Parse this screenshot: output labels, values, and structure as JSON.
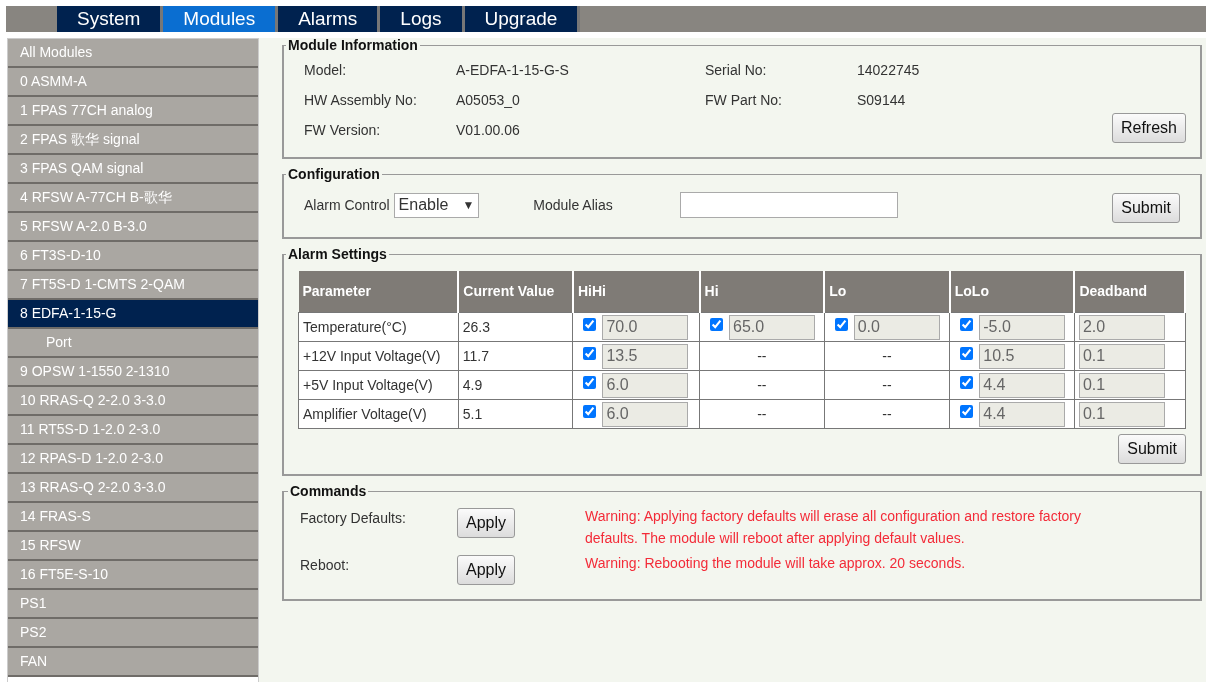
{
  "nav_tabs": [
    {
      "label": "System",
      "selected": false
    },
    {
      "label": "Modules",
      "selected": true
    },
    {
      "label": "Alarms",
      "selected": false
    },
    {
      "label": "Logs",
      "selected": false
    },
    {
      "label": "Upgrade",
      "selected": false
    }
  ],
  "sidebar": {
    "items": [
      {
        "label": "All Modules",
        "selected": false
      },
      {
        "label": "0 ASMM-A",
        "selected": false
      },
      {
        "label": "1 FPAS 77CH analog",
        "selected": false
      },
      {
        "label": "2 FPAS 歌华 signal",
        "selected": false
      },
      {
        "label": "3 FPAS QAM signal",
        "selected": false
      },
      {
        "label": "4 RFSW A-77CH B-歌华",
        "selected": false
      },
      {
        "label": "5 RFSW A-2.0 B-3.0",
        "selected": false
      },
      {
        "label": "6 FT3S-D-10",
        "selected": false
      },
      {
        "label": "7 FT5S-D 1-CMTS 2-QAM",
        "selected": false
      },
      {
        "label": "8 EDFA-1-15-G",
        "selected": true,
        "children": [
          {
            "label": "Port",
            "selected": false
          }
        ]
      },
      {
        "label": "9 OPSW 1-1550 2-1310",
        "selected": false
      },
      {
        "label": "10 RRAS-Q 2-2.0 3-3.0",
        "selected": false
      },
      {
        "label": "11 RT5S-D 1-2.0 2-3.0",
        "selected": false
      },
      {
        "label": "12 RPAS-D 1-2.0 2-3.0",
        "selected": false
      },
      {
        "label": "13 RRAS-Q 2-2.0 3-3.0",
        "selected": false
      },
      {
        "label": "14 FRAS-S",
        "selected": false
      },
      {
        "label": "15 RFSW",
        "selected": false
      },
      {
        "label": "16 FT5E-S-10",
        "selected": false
      },
      {
        "label": "PS1",
        "selected": false
      },
      {
        "label": "PS2",
        "selected": false
      },
      {
        "label": "FAN",
        "selected": false
      }
    ]
  },
  "module_information": {
    "title": "Module Information",
    "fields": [
      {
        "label": "Model:",
        "value": "A-EDFA-1-15-G-S"
      },
      {
        "label": "Serial No:",
        "value": "14022745"
      },
      {
        "label": "HW Assembly No:",
        "value": "A05053_0"
      },
      {
        "label": "FW Part No:",
        "value": "S09144"
      },
      {
        "label": "FW Version:",
        "value": "V01.00.06"
      }
    ],
    "button": "Refresh"
  },
  "configuration": {
    "title": "Configuration",
    "alarm_control_label": "Alarm Control",
    "alarm_control_value": "Enable",
    "dropdown_arrow": "▼",
    "alias_label": "Module Alias",
    "button": "Submit"
  },
  "alarm_settings": {
    "title": "Alarm Settings",
    "columns": [
      "Parameter",
      "Current Value",
      "HiHi",
      "Hi",
      "Lo",
      "LoLo",
      "Deadband"
    ],
    "rows": [
      {
        "parameter": "Temperature(°C)",
        "current": "26.3",
        "thresholds": [
          {
            "kind": "field",
            "checked": true,
            "value": "70.0"
          },
          {
            "kind": "field",
            "checked": true,
            "value": "65.0"
          },
          {
            "kind": "field",
            "checked": true,
            "value": "0.0"
          },
          {
            "kind": "field",
            "checked": true,
            "value": "-5.0"
          }
        ],
        "deadband": "2.0"
      },
      {
        "parameter": "+12V Input Voltage(V)",
        "current": "11.7",
        "thresholds": [
          {
            "kind": "field",
            "checked": true,
            "value": "13.5"
          },
          {
            "kind": "none",
            "text": "--"
          },
          {
            "kind": "none",
            "text": "--"
          },
          {
            "kind": "field",
            "checked": true,
            "value": "10.5"
          }
        ],
        "deadband": "0.1"
      },
      {
        "parameter": "+5V Input Voltage(V)",
        "current": "4.9",
        "thresholds": [
          {
            "kind": "field",
            "checked": true,
            "value": "6.0"
          },
          {
            "kind": "none",
            "text": "--"
          },
          {
            "kind": "none",
            "text": "--"
          },
          {
            "kind": "field",
            "checked": true,
            "value": "4.4"
          }
        ],
        "deadband": "0.1"
      },
      {
        "parameter": "Amplifier Voltage(V)",
        "current": "5.1",
        "thresholds": [
          {
            "kind": "field",
            "checked": true,
            "value": "6.0"
          },
          {
            "kind": "none",
            "text": "--"
          },
          {
            "kind": "none",
            "text": "--"
          },
          {
            "kind": "field",
            "checked": true,
            "value": "4.4"
          }
        ],
        "deadband": "0.1"
      }
    ],
    "button": "Submit"
  },
  "commands": {
    "title": "Commands",
    "items": [
      {
        "label": "Factory Defaults:",
        "button": "Apply",
        "warning": "Warning: Applying factory defaults will erase all configuration and restore factory defaults. The module will reboot after applying default values."
      },
      {
        "label": "Reboot:",
        "button": "Apply",
        "warning": "Warning: Rebooting the module will take approx. 20 seconds."
      }
    ]
  }
}
